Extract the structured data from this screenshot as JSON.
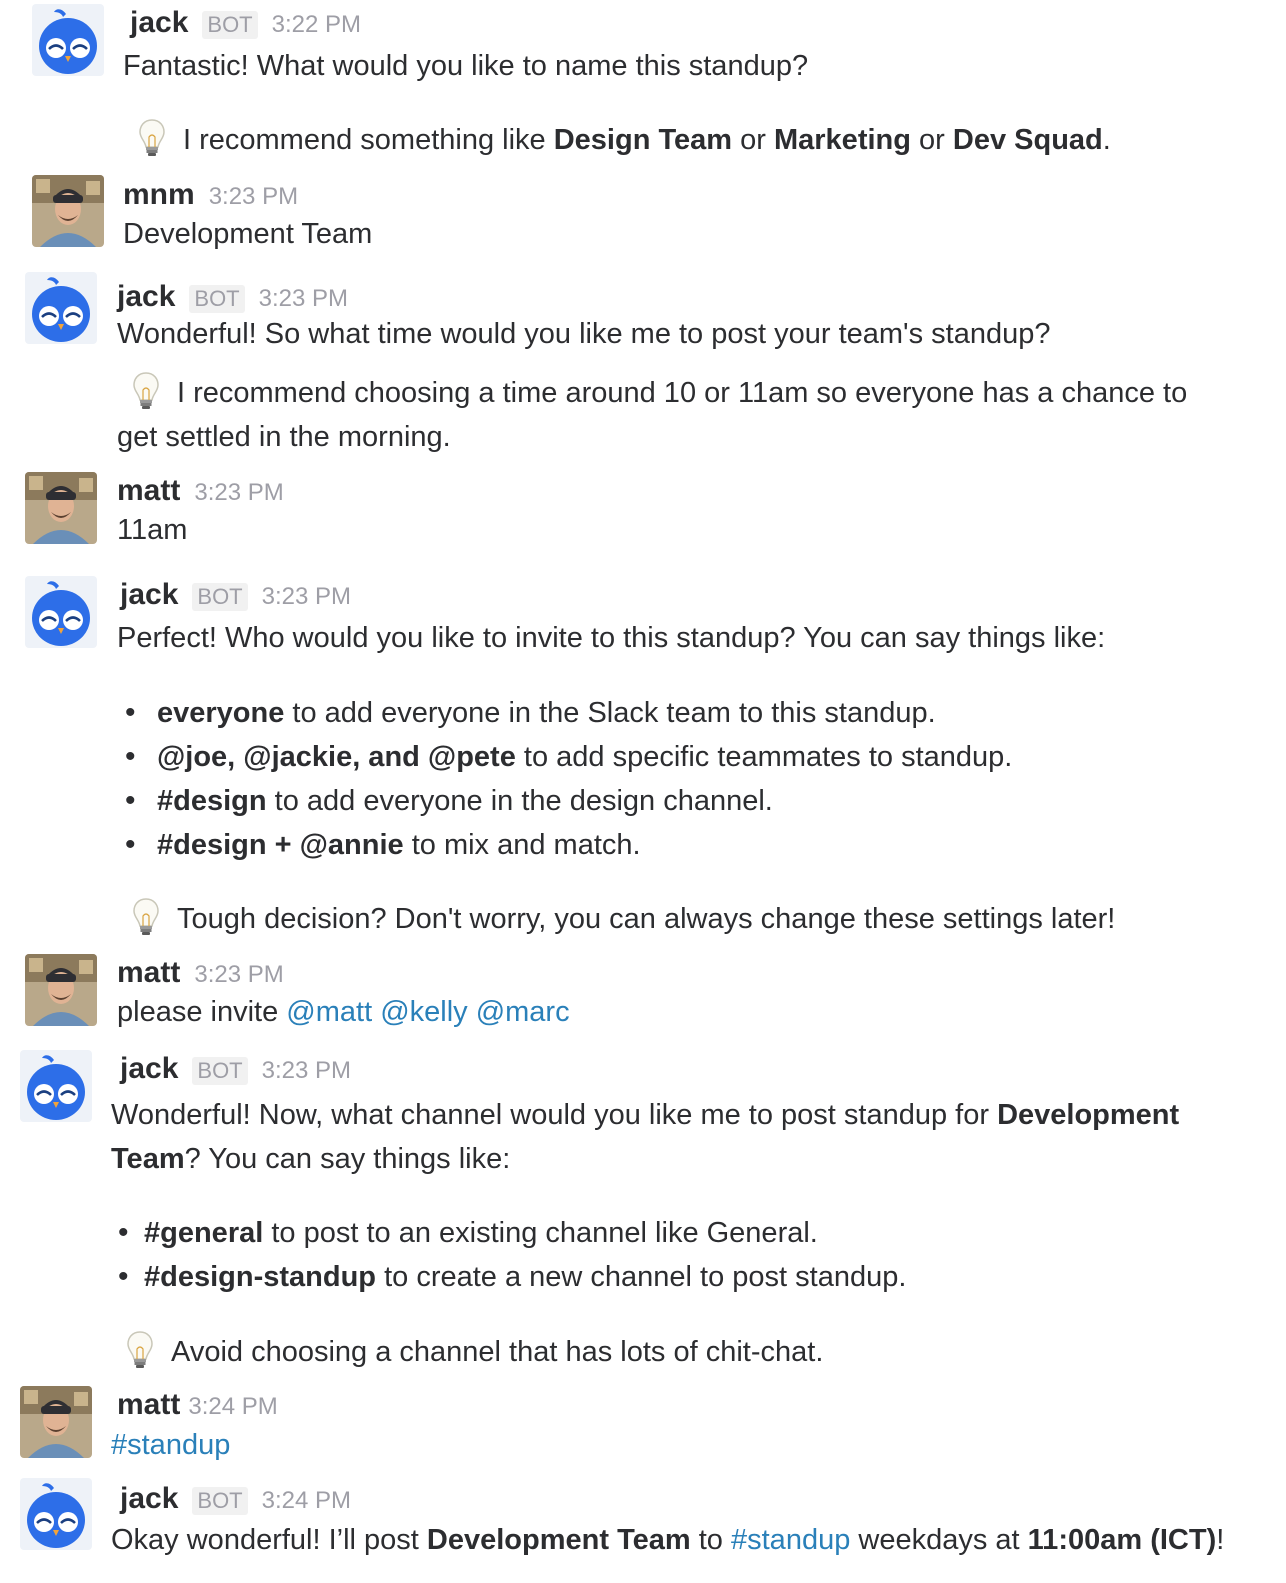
{
  "icons": {
    "bot_avatar": "blue-bird-avatar-icon",
    "user_avatar": "user-photo-avatar",
    "tip": "lightbulb-icon"
  },
  "colors": {
    "text": "#2c2d30",
    "muted": "#9e9ea6",
    "link": "#2a80b9",
    "bird": "#2d6ee8"
  },
  "messages": [
    {
      "author": "jack",
      "badge": "BOT",
      "time": "3:22 PM",
      "line1": "Fantastic! What would you like to name this standup?",
      "tip": {
        "t1": "I recommend something like ",
        "b1": "Design Team",
        "t2": " or ",
        "b2": "Marketing",
        "t3": " or ",
        "b3": "Dev Squad",
        "t4": "."
      }
    },
    {
      "author": "mnm",
      "time": "3:23 PM",
      "line1": "Development Team"
    },
    {
      "author": "jack",
      "badge": "BOT",
      "time": "3:23 PM",
      "line1": "Wonderful! So what time would you like me to post your team's standup?",
      "tip_line1": "I recommend choosing a time around 10 or 11am so everyone has a chance to",
      "tip_line2": "get settled in the morning."
    },
    {
      "author": "matt",
      "time": "3:23 PM",
      "line1": "11am"
    },
    {
      "author": "jack",
      "badge": "BOT",
      "time": "3:23 PM",
      "line1": "Perfect! Who would you like to invite to this standup? You can say things like:",
      "bullets": [
        {
          "b": "everyone",
          "t": " to add everyone in the Slack team to this standup."
        },
        {
          "b": "@joe, @jackie, and @pete",
          "t": " to add specific teammates to standup."
        },
        {
          "b": "#design",
          "t": " to add everyone in the design channel."
        },
        {
          "b": "#design + @annie",
          "t": " to mix and match."
        }
      ],
      "tip": "Tough decision? Don't worry, you can always change these settings later!"
    },
    {
      "author": "matt",
      "time": "3:23 PM",
      "text": "please invite ",
      "mentions": [
        "@matt",
        "@kelly",
        "@marc"
      ]
    },
    {
      "author": "jack",
      "badge": "BOT",
      "time": "3:23 PM",
      "line1": "Wonderful! Now, what channel would you like me to post standup for ",
      "line1_bold": "Development",
      "line2_bold": "Team",
      "line2": "? You can say things like:",
      "bullets": [
        {
          "b": "#general",
          "t": " to post to an existing channel like General."
        },
        {
          "b": "#design-standup",
          "t": " to create a new channel to post standup."
        }
      ],
      "tip": "Avoid choosing a channel that has lots of chit-chat."
    },
    {
      "author": "matt",
      "time": "3:24 PM",
      "channel": "#standup"
    },
    {
      "author": "jack",
      "badge": "BOT",
      "time": "3:24 PM",
      "t1": "Okay wonderful! I’ll post ",
      "b1": "Development Team",
      "t2": " to ",
      "channel": "#standup",
      "t3": " weekdays at ",
      "b2": "11:00am (ICT)",
      "t4": "!"
    }
  ]
}
